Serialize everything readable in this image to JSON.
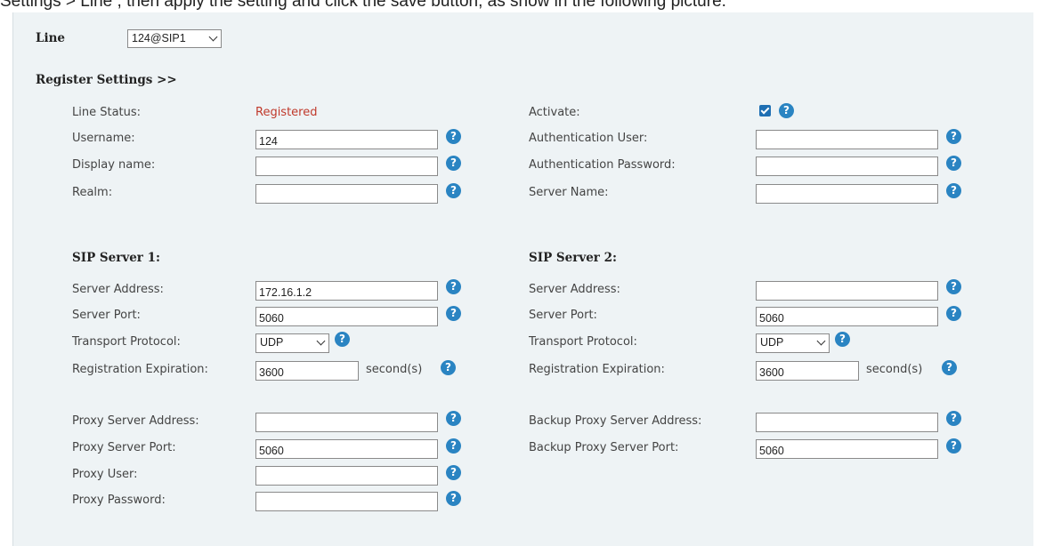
{
  "top_strip_text": "Settings >  Line , then apply the setting and click the save button, as show in the following picture.",
  "line_selector": {
    "label": "Line",
    "value": "124@SIP1"
  },
  "register_settings_header": "Register Settings >>",
  "left": {
    "line_status_label": "Line Status:",
    "line_status_value": "Registered",
    "username_label": "Username:",
    "username_value": "124",
    "display_name_label": "Display name:",
    "display_name_value": "",
    "realm_label": "Realm:",
    "realm_value": ""
  },
  "right": {
    "activate_label": "Activate:",
    "activate_checked": true,
    "auth_user_label": "Authentication User:",
    "auth_user_value": "",
    "auth_password_label": "Authentication Password:",
    "auth_password_value": "",
    "server_name_label": "Server Name:",
    "server_name_value": ""
  },
  "sip_server_1": {
    "title": "SIP Server 1:",
    "address_label": "Server Address:",
    "address_value": "172.16.1.2",
    "port_label": "Server Port:",
    "port_value": "5060",
    "transport_label": "Transport Protocol:",
    "transport_value": "UDP",
    "expiration_label": "Registration Expiration:",
    "expiration_value": "3600",
    "expiration_unit": "second(s)"
  },
  "sip_server_2": {
    "title": "SIP Server 2:",
    "address_label": "Server Address:",
    "address_value": "",
    "port_label": "Server Port:",
    "port_value": "5060",
    "transport_label": "Transport Protocol:",
    "transport_value": "UDP",
    "expiration_label": "Registration Expiration:",
    "expiration_value": "3600",
    "expiration_unit": "second(s)"
  },
  "proxy": {
    "address_label": "Proxy Server Address:",
    "address_value": "",
    "port_label": "Proxy Server Port:",
    "port_value": "5060",
    "user_label": "Proxy User:",
    "user_value": "",
    "password_label": "Proxy Password:",
    "password_value": ""
  },
  "backup_proxy": {
    "address_label": "Backup Proxy Server Address:",
    "address_value": "",
    "port_label": "Backup Proxy Server Port:",
    "port_value": "5060"
  },
  "help_glyph": "?",
  "icons": {
    "help": "question-circle-icon",
    "checkbox": "check-icon",
    "dropdown": "chevron-down-icon"
  },
  "colors": {
    "panel_bg": "#eef3f5",
    "status_red": "#c0392b",
    "help_blue": "#2a84c2",
    "checkbox_blue": "#1f6fb3"
  }
}
